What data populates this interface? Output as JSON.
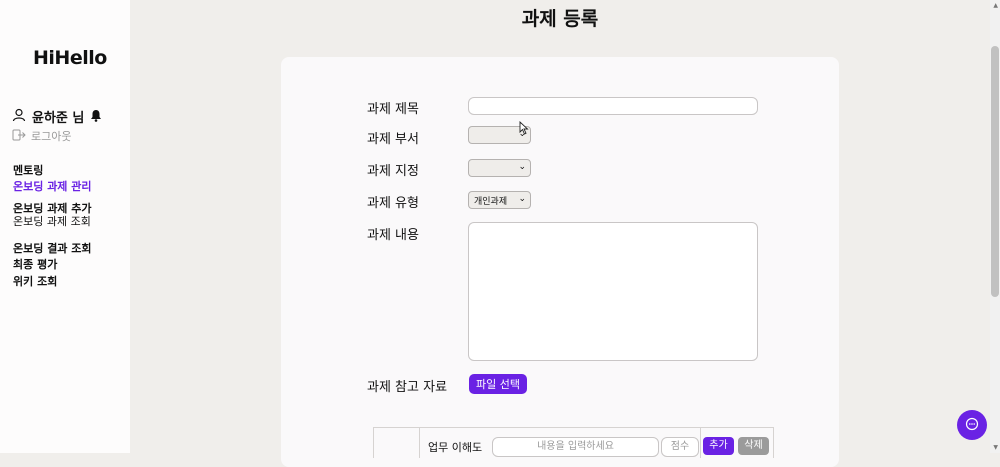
{
  "sidebar": {
    "logo": "HiHello",
    "user_name": "윤하준 님",
    "logout_label": "로그아웃",
    "menu": {
      "mentoring": "멘토링",
      "onboarding_manage": "온보딩 과제 관리",
      "onboarding_add": "온보딩 과제 추가",
      "onboarding_view": "온보딩 과제 조회",
      "onboarding_result": "온보딩 결과 조회",
      "final_eval": "최종 평가",
      "wiki": "위키 조회"
    }
  },
  "page": {
    "title": "과제 등록"
  },
  "form": {
    "title_label": "과제 제목",
    "title_value": "",
    "dept_label": "과제 부서",
    "dept_value": "",
    "assign_label": "과제 지정",
    "assign_value": "",
    "type_label": "과제 유형",
    "type_value": "개인과제",
    "content_label": "과제 내용",
    "content_value": "",
    "ref_label": "과제 참고 자료",
    "file_button": "파일 선택"
  },
  "eval_table": {
    "row_label": "업무 이해도",
    "input_placeholder": "내용을 입력하세요",
    "score_placeholder": "점수",
    "add_button": "추가",
    "delete_button": "삭제"
  },
  "colors": {
    "accent": "#6a22e4",
    "delete": "#9b9b9b"
  },
  "icons": [
    "user-icon",
    "bell-icon",
    "logout-icon",
    "chevron-down-icon",
    "chat-icon"
  ]
}
